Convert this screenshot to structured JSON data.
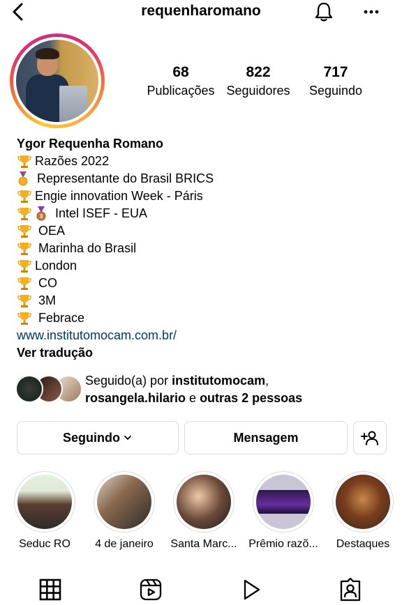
{
  "header": {
    "username": "requenharomano",
    "icons": {
      "back": "chevron-left-icon",
      "notifications": "bell-icon",
      "more": "more-horizontal-icon"
    }
  },
  "stats": [
    {
      "value": "68",
      "label": "Publicações"
    },
    {
      "value": "822",
      "label": "Seguidores"
    },
    {
      "value": "717",
      "label": "Seguindo"
    }
  ],
  "bio": {
    "name": "Ygor Requenha Romano",
    "lines": [
      {
        "emoji": "trophy",
        "text": "Razões 2022"
      },
      {
        "emoji": "gold-medal",
        "text": " Representante do Brasil BRICS"
      },
      {
        "emoji": "trophy",
        "text": "Engie innovation Week - Páris"
      },
      {
        "emoji": "trophy+bronze-medal",
        "text": " Intel ISEF - EUA"
      },
      {
        "emoji": "trophy",
        "text": " OEA"
      },
      {
        "emoji": "trophy",
        "text": " Marinha do Brasil"
      },
      {
        "emoji": "trophy",
        "text": "London"
      },
      {
        "emoji": "trophy",
        "text": " CO"
      },
      {
        "emoji": "trophy",
        "text": " 3M"
      },
      {
        "emoji": "trophy",
        "text": " Febrace"
      }
    ],
    "link": "www.institutomocam.com.br/",
    "translate": "Ver tradução"
  },
  "followed_by": {
    "prefix": "Seguido(a) por ",
    "user1": "institutomocam",
    "sep": ",",
    "user2": "rosangela.hilario",
    "middle": " e ",
    "others": "outras 2 pessoas"
  },
  "actions": {
    "following_label": "Seguindo",
    "message_label": "Mensagem",
    "add_user_icon": "add-user-icon"
  },
  "highlights": [
    {
      "label": "Seduc RO"
    },
    {
      "label": "4 de janeiro"
    },
    {
      "label": "Santa Marc..."
    },
    {
      "label": "Prêmio razõ..."
    },
    {
      "label": "Destaques"
    }
  ],
  "tabs": [
    {
      "icon": "grid-icon",
      "active": true
    },
    {
      "icon": "reels-icon",
      "active": false
    },
    {
      "icon": "play-icon",
      "active": false
    },
    {
      "icon": "tagged-icon",
      "active": false
    }
  ],
  "colors": {
    "link": "#00376b",
    "border": "#dbdbdb",
    "text": "#000000"
  }
}
